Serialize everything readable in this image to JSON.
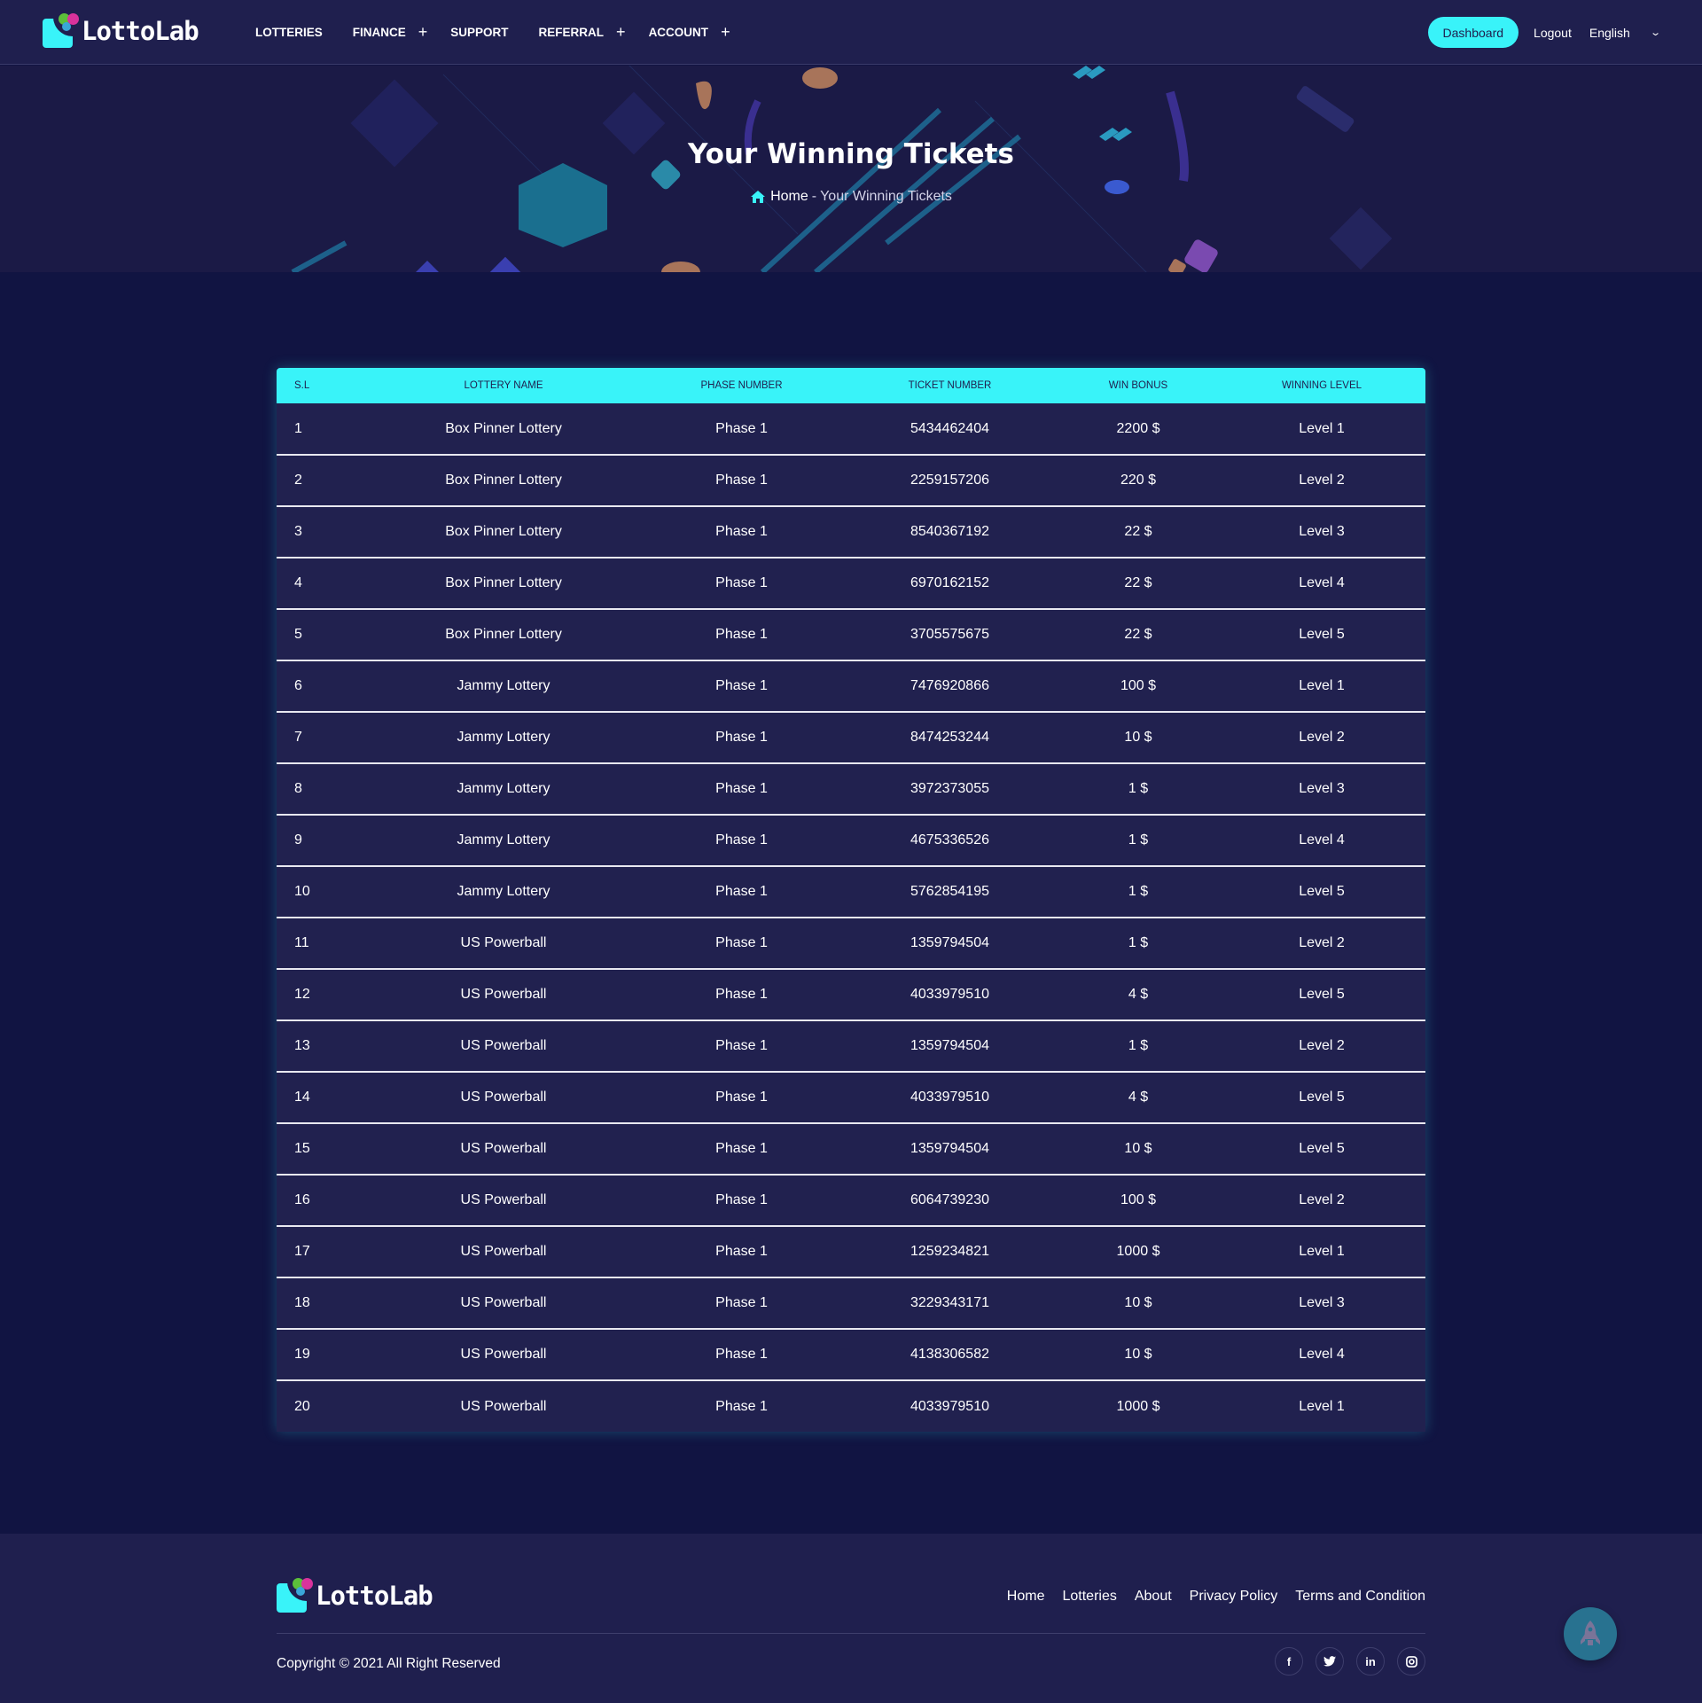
{
  "brand": {
    "name": "LottoLab",
    "accent_color": "#39f3f9",
    "bg_color": "#111442",
    "panel_color": "#1f1f4e"
  },
  "nav": {
    "items": [
      {
        "label": "LOTTERIES",
        "has_submenu": false
      },
      {
        "label": "FINANCE",
        "has_submenu": true
      },
      {
        "label": "SUPPORT",
        "has_submenu": false
      },
      {
        "label": "REFERRAL",
        "has_submenu": true
      },
      {
        "label": "ACCOUNT",
        "has_submenu": true
      }
    ],
    "submenu_icon": "+",
    "dashboard_label": "Dashboard",
    "logout_label": "Logout",
    "language": {
      "selected": "English",
      "icon": "chevron-down-icon"
    }
  },
  "hero": {
    "title": "Your Winning Tickets",
    "breadcrumb": {
      "home": "Home",
      "separator": "-",
      "current": "Your Winning Tickets"
    }
  },
  "table": {
    "headers": [
      "S.L",
      "LOTTERY NAME",
      "PHASE NUMBER",
      "TICKET NUMBER",
      "WIN BONUS",
      "WINNING LEVEL"
    ],
    "rows": [
      [
        "1",
        "Box Pinner Lottery",
        "Phase 1",
        "5434462404",
        "2200 $",
        "Level 1"
      ],
      [
        "2",
        "Box Pinner Lottery",
        "Phase 1",
        "2259157206",
        "220 $",
        "Level 2"
      ],
      [
        "3",
        "Box Pinner Lottery",
        "Phase 1",
        "8540367192",
        "22 $",
        "Level 3"
      ],
      [
        "4",
        "Box Pinner Lottery",
        "Phase 1",
        "6970162152",
        "22 $",
        "Level 4"
      ],
      [
        "5",
        "Box Pinner Lottery",
        "Phase 1",
        "3705575675",
        "22 $",
        "Level 5"
      ],
      [
        "6",
        "Jammy Lottery",
        "Phase 1",
        "7476920866",
        "100 $",
        "Level 1"
      ],
      [
        "7",
        "Jammy Lottery",
        "Phase 1",
        "8474253244",
        "10 $",
        "Level 2"
      ],
      [
        "8",
        "Jammy Lottery",
        "Phase 1",
        "3972373055",
        "1 $",
        "Level 3"
      ],
      [
        "9",
        "Jammy Lottery",
        "Phase 1",
        "4675336526",
        "1 $",
        "Level 4"
      ],
      [
        "10",
        "Jammy Lottery",
        "Phase 1",
        "5762854195",
        "1 $",
        "Level 5"
      ],
      [
        "11",
        "US Powerball",
        "Phase 1",
        "1359794504",
        "1 $",
        "Level 2"
      ],
      [
        "12",
        "US Powerball",
        "Phase 1",
        "4033979510",
        "4 $",
        "Level 5"
      ],
      [
        "13",
        "US Powerball",
        "Phase 1",
        "1359794504",
        "1 $",
        "Level 2"
      ],
      [
        "14",
        "US Powerball",
        "Phase 1",
        "4033979510",
        "4 $",
        "Level 5"
      ],
      [
        "15",
        "US Powerball",
        "Phase 1",
        "1359794504",
        "10 $",
        "Level 5"
      ],
      [
        "16",
        "US Powerball",
        "Phase 1",
        "6064739230",
        "100 $",
        "Level 2"
      ],
      [
        "17",
        "US Powerball",
        "Phase 1",
        "1259234821",
        "1000 $",
        "Level 1"
      ],
      [
        "18",
        "US Powerball",
        "Phase 1",
        "3229343171",
        "10 $",
        "Level 3"
      ],
      [
        "19",
        "US Powerball",
        "Phase 1",
        "4138306582",
        "10 $",
        "Level 4"
      ],
      [
        "20",
        "US Powerball",
        "Phase 1",
        "4033979510",
        "1000 $",
        "Level 1"
      ]
    ]
  },
  "footer": {
    "links": [
      "Home",
      "Lotteries",
      "About",
      "Privacy Policy",
      "Terms and Condition"
    ],
    "copyright": "Copyright © 2021 All Right Reserved",
    "socials": [
      {
        "name": "facebook-icon",
        "glyph": "f"
      },
      {
        "name": "twitter-icon",
        "glyph": "🐦"
      },
      {
        "name": "linkedin-icon",
        "glyph": "in"
      },
      {
        "name": "instagram-icon",
        "glyph": "◎"
      }
    ],
    "scroll_top_icon": "rocket-icon"
  }
}
